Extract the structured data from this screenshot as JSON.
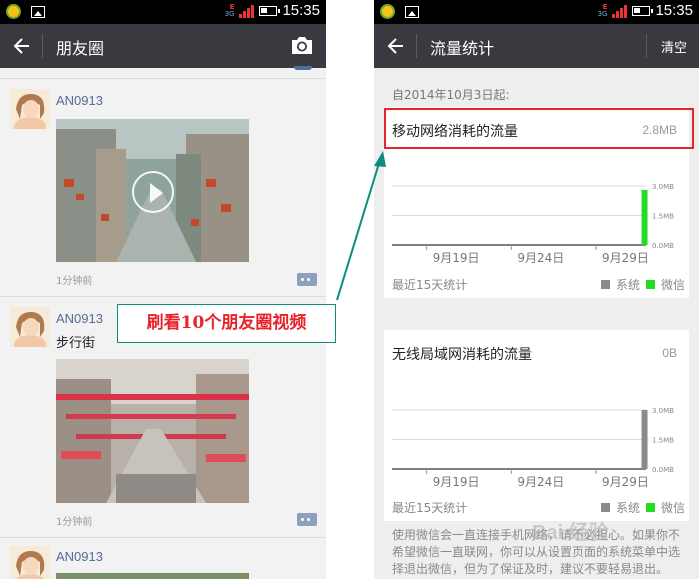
{
  "status_bar": {
    "time": "15:35",
    "network_e": "E",
    "network_3g": "3G"
  },
  "moments": {
    "title": "朋友圈",
    "posts": [
      {
        "author": "AN0913",
        "text": "",
        "media": "video",
        "time": "1分钟前"
      },
      {
        "author": "AN0913",
        "text": "步行街",
        "media": "photo",
        "time": "1分钟前"
      },
      {
        "author": "AN0913",
        "text": "",
        "media": "photo",
        "time": ""
      }
    ]
  },
  "traffic": {
    "title": "流量统计",
    "clear_label": "清空",
    "since_label": "自2014年10月3日起:",
    "mobile": {
      "title": "移动网络消耗的流量",
      "value": "2.8MB",
      "footer": "最近15天统计"
    },
    "wifi": {
      "title": "无线局域网消耗的流量",
      "value": "0B",
      "footer": "最近15天统计"
    },
    "legend": {
      "system": "系统",
      "wechat": "微信"
    },
    "note": "使用微信会一直连接手机网络，请不必担心。如果你不希望微信一直联网，你可以从设置页面的系统菜单中选择退出微信，但为了保证及时，建议不要轻易退出。"
  },
  "chart_data": [
    {
      "type": "bar",
      "title": "移动网络消耗的流量",
      "categories": [
        "9月19日",
        "9月24日",
        "9月29日"
      ],
      "y_ticks": [
        "3.0MB",
        "1.5MB",
        "0.0MB"
      ],
      "ylim": [
        0,
        3.0
      ],
      "series": [
        {
          "name": "系统",
          "color": "#8a8a8a",
          "values": [
            {
              "day_index": 15,
              "value": 0
            }
          ]
        },
        {
          "name": "微信",
          "color": "#22dd22",
          "values": [
            {
              "day_index": 15,
              "value": 2.8
            }
          ]
        }
      ],
      "footer": "最近15天统计",
      "legend": "bottom-right"
    },
    {
      "type": "bar",
      "title": "无线局域网消耗的流量",
      "categories": [
        "9月19日",
        "9月24日",
        "9月29日"
      ],
      "y_ticks": [
        "3.0MB",
        "1.5MB",
        "0.0MB"
      ],
      "ylim": [
        0,
        3.0
      ],
      "series": [
        {
          "name": "系统",
          "color": "#8a8a8a",
          "values": [
            {
              "day_index": 15,
              "value": 3.0
            }
          ]
        },
        {
          "name": "微信",
          "color": "#22dd22",
          "values": [
            {
              "day_index": 15,
              "value": 0
            }
          ]
        }
      ],
      "footer": "最近15天统计",
      "legend": "bottom-right"
    }
  ],
  "annotation": {
    "callout": "刷看10个朋友圈视频",
    "colors": {
      "callout_text": "#e8232d",
      "callout_border": "#0e8c7c",
      "highlight": "#e8232d"
    }
  },
  "watermark": "Bai 经验"
}
